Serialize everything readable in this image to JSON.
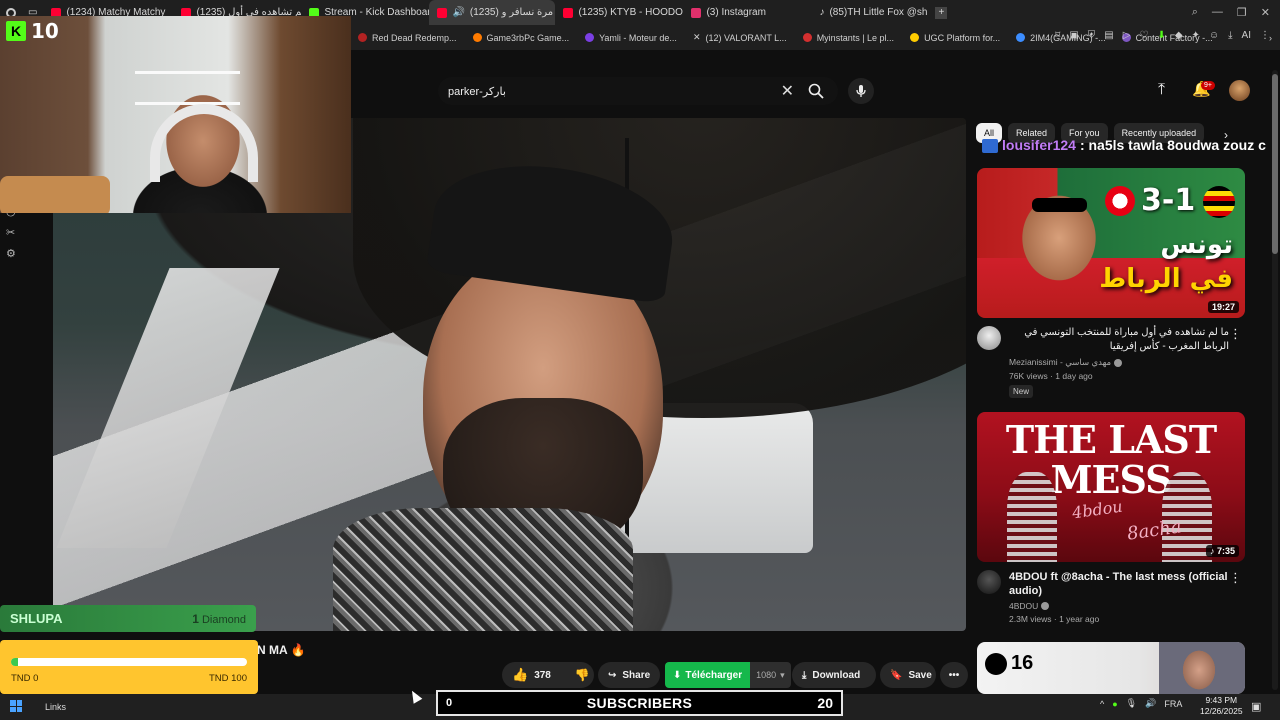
{
  "browser": {
    "tabs": [
      {
        "label": "(1234) Matchy Matchy",
        "color": "#ff0033"
      },
      {
        "label": "(1235) ما لم تشاهده في أول",
        "color": "#ff0033"
      },
      {
        "label": "Stream - Kick Dashboard",
        "color": "#53fc18"
      },
      {
        "label": "(1235) أول مرة نسافر و",
        "color": "#ff0033",
        "active": true
      },
      {
        "label": "(1235) KTYB - HOODOO",
        "color": "#ff0033"
      },
      {
        "label": "(3) Instagram",
        "color": "#e1306c"
      },
      {
        "label": "(85)TH Little Fox @sh",
        "color": "#000000"
      }
    ],
    "bookmarks": [
      {
        "label": "Red Dead Redemp...",
        "color": "#b22222"
      },
      {
        "label": "Game3rbPc Game...",
        "color": "#ff7b00"
      },
      {
        "label": "Yamli - Moteur de...",
        "color": "#7b3fe4"
      },
      {
        "label": "(12) VALORANT L...",
        "color": "#000000"
      },
      {
        "label": "Myinstants | Le pl...",
        "color": "#d32f2f"
      },
      {
        "label": "UGC Platform for...",
        "color": "#ffcc00"
      },
      {
        "label": "2IM4(GAMING) -...",
        "color": "#3c8dff"
      },
      {
        "label": "Content Factory -...",
        "color": "#7e57c2"
      }
    ],
    "ai_label": "AI"
  },
  "youtube": {
    "search": {
      "value": "parker-باركر"
    },
    "notifications_badge": "9+",
    "chips": [
      "All",
      "Related",
      "For you",
      "Recently uploaded"
    ],
    "chat_overlay": {
      "user": "lousifer124",
      "message": ": na5ls tawla 8oudwa zouz c"
    },
    "recommendations": [
      {
        "title": "ما لم تشاهده في أول مباراة للمنتخب التونسي في الرباط المغرب - كأس إفريقيا",
        "channel": "Mezianissimi - مهدي ساسي",
        "stats": "76K views · 1 day ago",
        "badge": "New",
        "duration": "19:27",
        "thumb_score": "3-1",
        "thumb_text_line1": "تونس",
        "thumb_text_line2": "في الرباط"
      },
      {
        "title": "4BDOU ft @8acha  - The last mess (official audio)",
        "channel": "4BDOU",
        "stats": "2.3M views · 1 year ago",
        "duration": "7:35",
        "thumb_text": "THE LAST MESS",
        "thumb_sign1": "4bdou",
        "thumb_sign2": "8acha"
      },
      {
        "thumb_number": "16"
      }
    ],
    "video": {
      "title_fragment": "N MA 🔥",
      "likes": "378",
      "share_label": "Share",
      "telecharger_label": "Télécharger",
      "quality": "1080",
      "download_label": "Download",
      "save_label": "Save"
    }
  },
  "kick": {
    "viewer_count": "10",
    "goal": {
      "name": "SHLUPA",
      "diamond_count": "1",
      "diamond_label": "Diamond",
      "progress_fraction": 0.03,
      "left_label": "TND 0",
      "right_label": "TND 100"
    },
    "subscribers_label": "SUBSCRIBERS",
    "subscribers_value": "20",
    "subscribers_zero": "0"
  },
  "taskbar": {
    "links_label": "Links",
    "lang": "FRA",
    "time": "9:43 PM",
    "date": "12/26/2025"
  }
}
